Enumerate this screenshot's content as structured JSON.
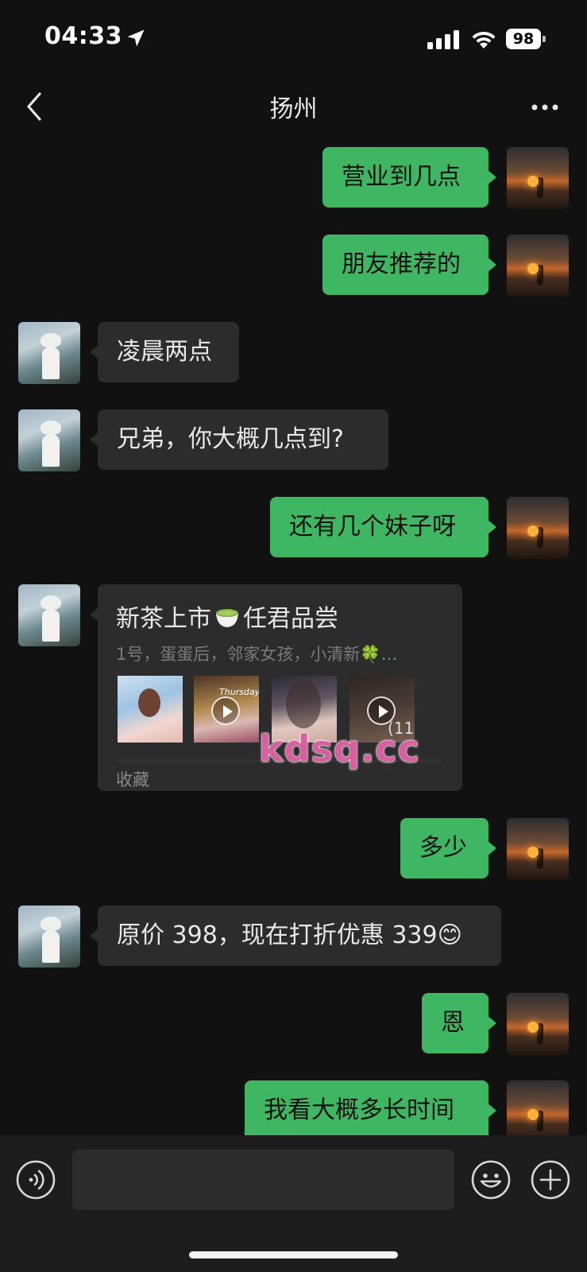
{
  "status_bar": {
    "time": "04:33",
    "battery": "98"
  },
  "header": {
    "title": "扬州"
  },
  "messages": [
    {
      "from": "me",
      "text": "营业到几点"
    },
    {
      "from": "me",
      "text": "朋友推荐的"
    },
    {
      "from": "them",
      "text": "凌晨两点"
    },
    {
      "from": "them",
      "text": "兄弟，你大概几点到?"
    },
    {
      "from": "me",
      "text": "还有几个妹子呀"
    },
    {
      "from": "me",
      "text": "多少"
    },
    {
      "from": "them",
      "text": "原价 398，现在打折优惠 339😊"
    },
    {
      "from": "me",
      "text": "恩"
    },
    {
      "from": "me",
      "text": "我看大概多长时间"
    }
  ],
  "card": {
    "title_before": "新茶上市",
    "title_after": "任君品尝",
    "subtitle": "1号，蛋蛋后，邻家女孩，小清新",
    "subtitle_suffix": "🍀…",
    "thumb_label": "Thursday",
    "more_count": "(11)",
    "footer": "收藏"
  },
  "watermark": "kdsq.cc",
  "icons": [
    "back-icon",
    "more-icon",
    "location-arrow-icon",
    "signal-icon",
    "wifi-icon",
    "voice-icon",
    "emoji-icon",
    "plus-icon",
    "teacup-icon",
    "play-icon"
  ],
  "colors": {
    "background": "#111111",
    "bubble_me": "#3eb662",
    "bubble_them": "#2c2c2c",
    "watermark": "#d8609f"
  }
}
